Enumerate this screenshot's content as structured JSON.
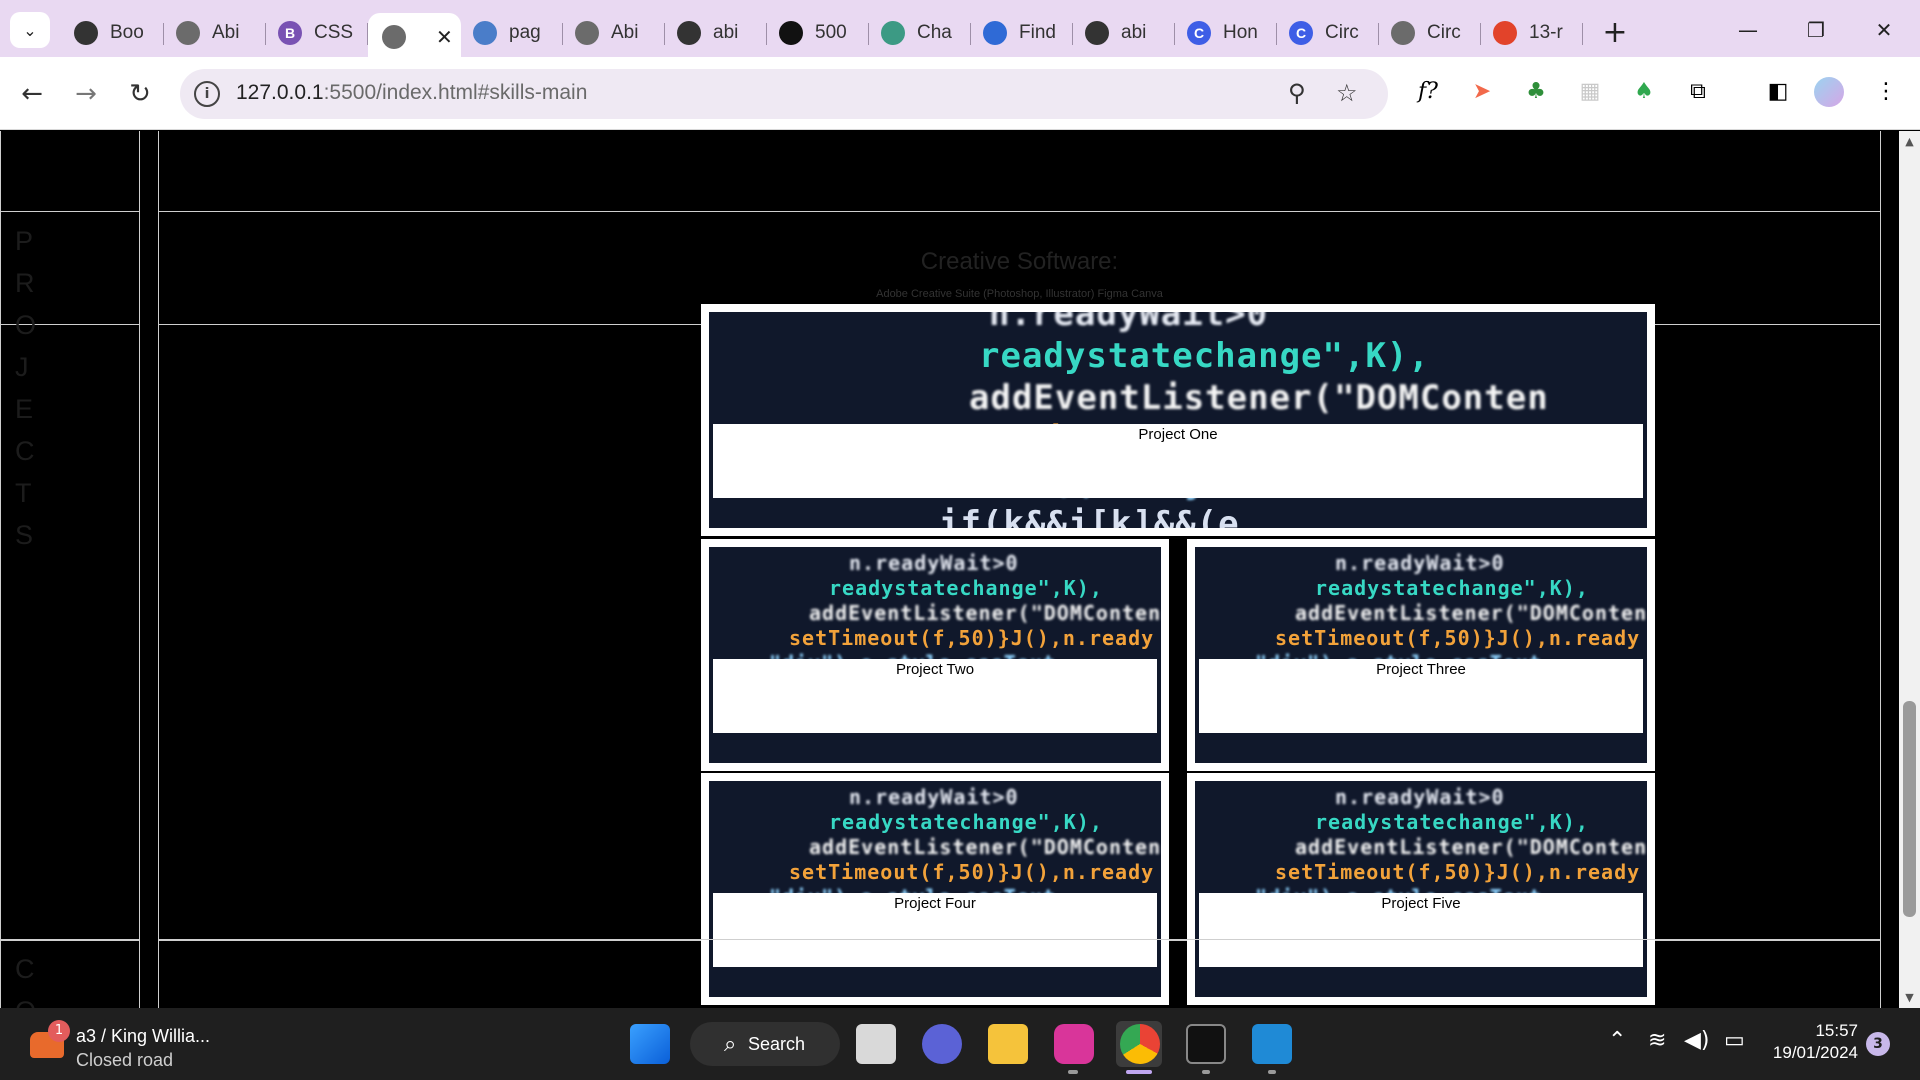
{
  "browser": {
    "tabs": [
      {
        "label": "Boo",
        "icon": "github-icon",
        "color": "#333333"
      },
      {
        "label": "Abi",
        "icon": "globe-icon",
        "color": "#6b6b6b"
      },
      {
        "label": "CSS",
        "icon": "bootstrap-icon",
        "color": "#7952b3",
        "glyph": "B"
      },
      {
        "label": "",
        "icon": "globe-icon",
        "color": "#6b6b6b",
        "active": true,
        "close": "✕"
      },
      {
        "label": "pag",
        "icon": "check-globe-icon",
        "color": "#4a7dc9"
      },
      {
        "label": "Abi",
        "icon": "globe-icon",
        "color": "#6b6b6b"
      },
      {
        "label": "abi",
        "icon": "github-icon",
        "color": "#333333"
      },
      {
        "label": "500",
        "icon": "codecademy-icon",
        "color": "#111111"
      },
      {
        "label": "Cha",
        "icon": "chatgpt-icon",
        "color": "#3c9a84"
      },
      {
        "label": "Find",
        "icon": "flag-icon",
        "color": "#2f6ad6"
      },
      {
        "label": "abi",
        "icon": "github-icon",
        "color": "#333333"
      },
      {
        "label": "Hon",
        "icon": "circle-c-icon",
        "color": "#3e5ee6",
        "glyph": "C"
      },
      {
        "label": "Circ",
        "icon": "circle-c-icon",
        "color": "#3e5ee6",
        "glyph": "C"
      },
      {
        "label": "Circ",
        "icon": "globe-icon",
        "color": "#6b6b6b"
      },
      {
        "label": "13-r",
        "icon": "gitlab-icon",
        "color": "#e2432a"
      }
    ],
    "new_tab": "+",
    "url_host": "127.0.0.1",
    "url_rest": ":5500/index.html#skills-main",
    "accent": "#e9d9f2"
  },
  "page": {
    "skills_heading": "Creative Software:",
    "skills_text": "Adobe Creative Suite (Photoshop, Illustrator) Figma Canva",
    "projects_letters": [
      "P",
      "R",
      "O",
      "J",
      "E",
      "C",
      "T",
      "S"
    ],
    "next_letters": [
      "C",
      "O"
    ],
    "projects": [
      {
        "label": "Project One"
      },
      {
        "label": "Project Two"
      },
      {
        "label": "Project Three"
      },
      {
        "label": "Project Four"
      },
      {
        "label": "Project Five"
      }
    ],
    "code_lines": [
      "n.readyWait>0",
      "readystatechange\",K),",
      "addEventListener(\"DOMConten",
      "setTimeout(f,50)}J(),n.ready",
      "\"div\"),e.style.cssText",
      "if(k&&j[k]&&(e"
    ]
  },
  "taskbar": {
    "weather_title": "a3 / King Willia...",
    "weather_sub": "Closed road",
    "weather_badge": "1",
    "search_label": "Search",
    "time": "15:57",
    "date": "19/01/2024",
    "notifications": "3"
  }
}
